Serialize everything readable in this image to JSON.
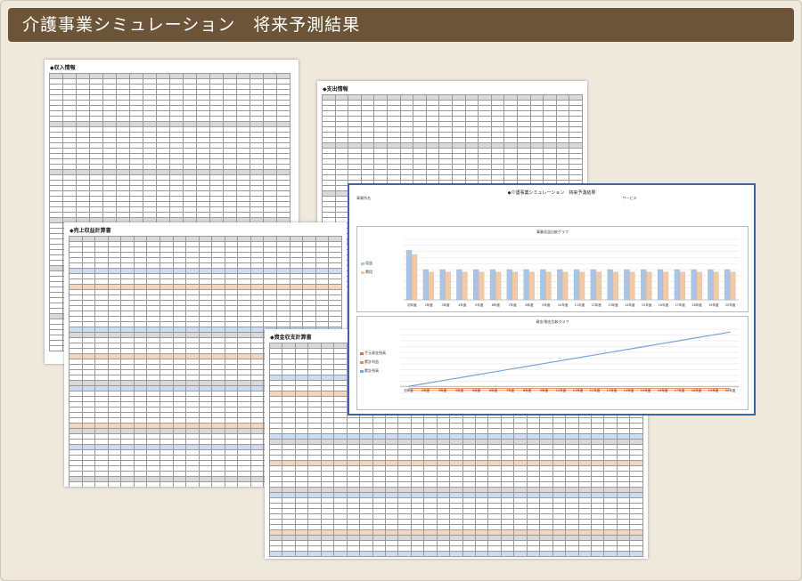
{
  "header": {
    "title": "介護事業シミュレーション　将来予測結果"
  },
  "sheets": {
    "income": {
      "title": "◆収入情報"
    },
    "expense": {
      "title": "◆支出情報"
    },
    "cashflow": {
      "title": "◆売上収益計算書"
    },
    "balance": {
      "title": "◆資金収支計算書"
    }
  },
  "chart_window": {
    "title": "◆介護事業シミュレーション　将来予測結果",
    "meta_left": "事業所名",
    "meta_right": "サービス",
    "chart_data": [
      {
        "type": "bar",
        "title": "事業収益比較グラフ",
        "categories": [
          "初年度",
          "2年度",
          "3年度",
          "4年度",
          "5年度",
          "6年度",
          "7年度",
          "8年度",
          "9年度",
          "10年度",
          "11年度",
          "12年度",
          "13年度",
          "14年度",
          "15年度",
          "16年度",
          "17年度",
          "18年度",
          "19年度",
          "20年度"
        ],
        "series": [
          {
            "name": "収益",
            "values": [
              82,
              50,
              50,
              50,
              50,
              50,
              50,
              50,
              50,
              50,
              50,
              50,
              50,
              50,
              50,
              50,
              50,
              50,
              50,
              50
            ]
          },
          {
            "name": "費用",
            "values": [
              75,
              46,
              46,
              46,
              46,
              46,
              46,
              46,
              46,
              46,
              46,
              46,
              46,
              46,
              46,
              46,
              46,
              46,
              46,
              46
            ]
          }
        ],
        "ylim": [
          0,
          100
        ],
        "colors": [
          "#a9c4e6",
          "#f6c8a0"
        ]
      },
      {
        "type": "line",
        "title": "資金/借金比較グラフ",
        "categories": [
          "初年度",
          "2年度",
          "3年度",
          "4年度",
          "5年度",
          "6年度",
          "7年度",
          "8年度",
          "9年度",
          "10年度",
          "11年度",
          "12年度",
          "13年度",
          "14年度",
          "15年度",
          "16年度",
          "17年度",
          "18年度",
          "19年度",
          "20年度"
        ],
        "series": [
          {
            "name": "手元資金残高",
            "values": [
              -5,
              -5,
              -5,
              -5,
              -5,
              -5,
              -5,
              -5,
              -5,
              -5,
              -5,
              -5,
              -5,
              -5,
              -5,
              -5,
              -5,
              -5,
              -5,
              -5
            ]
          },
          {
            "name": "累計利益",
            "values": [
              -10,
              -10,
              -10,
              -10,
              -10,
              -10,
              -10,
              -10,
              -10,
              -10,
              -10,
              -10,
              -10,
              -10,
              -10,
              -10,
              -10,
              -10,
              -10,
              -10
            ]
          },
          {
            "name": "累計残高",
            "values": [
              0,
              7,
              14,
              21,
              28,
              35,
              42,
              49,
              56,
              63,
              70,
              77,
              84,
              91,
              98,
              105,
              112,
              119,
              126,
              133
            ]
          }
        ],
        "ylim": [
          -30,
          140
        ],
        "colors": [
          "#e06a4c",
          "#f08a3c",
          "#7aa3d8"
        ]
      }
    ]
  }
}
